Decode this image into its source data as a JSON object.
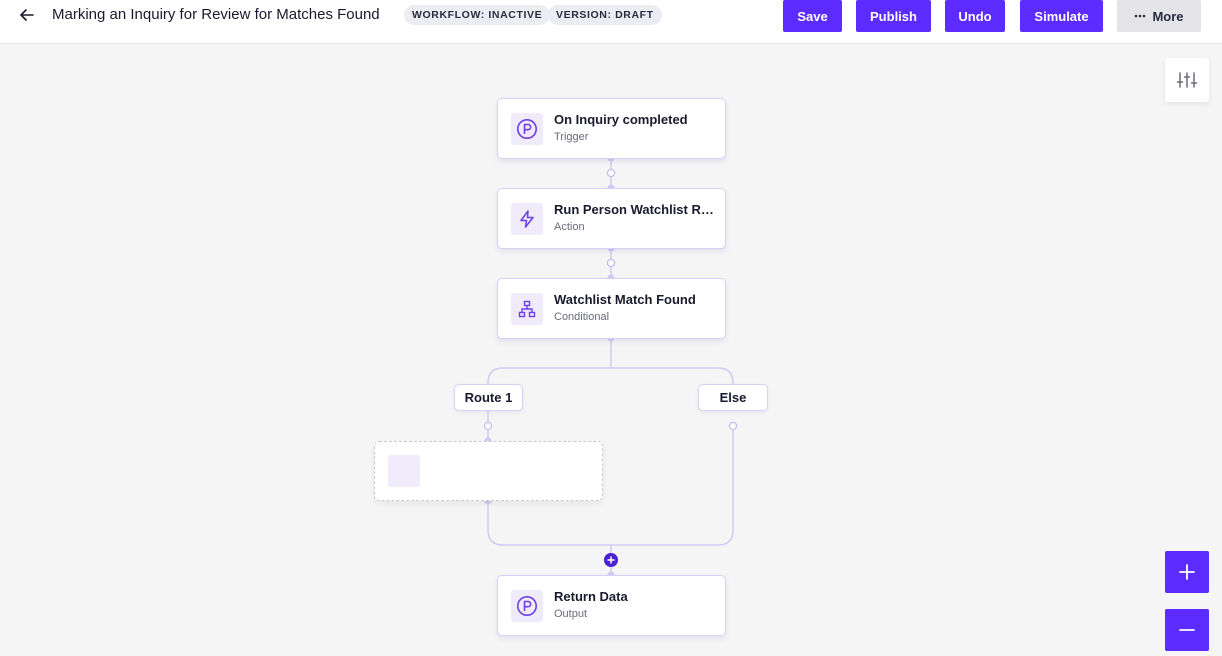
{
  "header": {
    "title": "Marking an Inquiry for Review for Matches Found",
    "badges": {
      "workflow": "WORKFLOW: INACTIVE",
      "version": "VERSION: DRAFT"
    },
    "buttons": {
      "save": "Save",
      "publish": "Publish",
      "undo": "Undo",
      "simulate": "Simulate",
      "more": "More"
    }
  },
  "nodes": {
    "trigger": {
      "title": "On Inquiry completed",
      "subtitle": "Trigger",
      "icon": "persona-logo-icon"
    },
    "action": {
      "title": "Run Person Watchlist Report",
      "subtitle": "Action",
      "icon": "lightning-icon"
    },
    "conditional": {
      "title": "Watchlist Match Found",
      "subtitle": "Conditional",
      "icon": "branch-icon"
    },
    "output": {
      "title": "Return Data",
      "subtitle": "Output",
      "icon": "persona-logo-icon"
    }
  },
  "routes": {
    "route1": "Route 1",
    "else": "Else"
  },
  "colors": {
    "accent": "#5b2bff",
    "connector": "#d3c9f3",
    "icon": "#6f3fe6"
  }
}
